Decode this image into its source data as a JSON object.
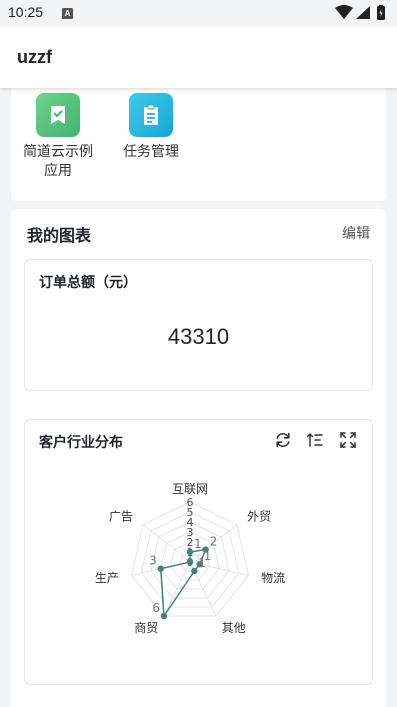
{
  "status_bar": {
    "time": "10:25",
    "notification_letter": "A"
  },
  "app_bar": {
    "title": "uzzf"
  },
  "apps": [
    {
      "label": "简道云示例应用",
      "icon": "bookmark-check-icon",
      "color_from": "#6fd08c",
      "color_to": "#3fb46a"
    },
    {
      "label": "任务管理",
      "icon": "clipboard-icon",
      "color_from": "#3fc6e6",
      "color_to": "#1aa8d4"
    }
  ],
  "my_charts": {
    "title": "我的图表",
    "edit_label": "编辑",
    "total_widget": {
      "title": "订单总额（元）",
      "value": "43310"
    },
    "industry_widget": {
      "title": "客户行业分布"
    }
  },
  "chart_data": {
    "type": "radar",
    "title": "客户行业分布",
    "indicators": [
      "互联网",
      "外贸",
      "物流",
      "其他",
      "商贸",
      "生产",
      "广告"
    ],
    "max": 6,
    "ticks": [
      0,
      1,
      2,
      3,
      4,
      5,
      6
    ],
    "series": [
      {
        "values": [
          1,
          2,
          1,
          1,
          6,
          3,
          0
        ],
        "color": "#4a7f7a"
      }
    ]
  }
}
